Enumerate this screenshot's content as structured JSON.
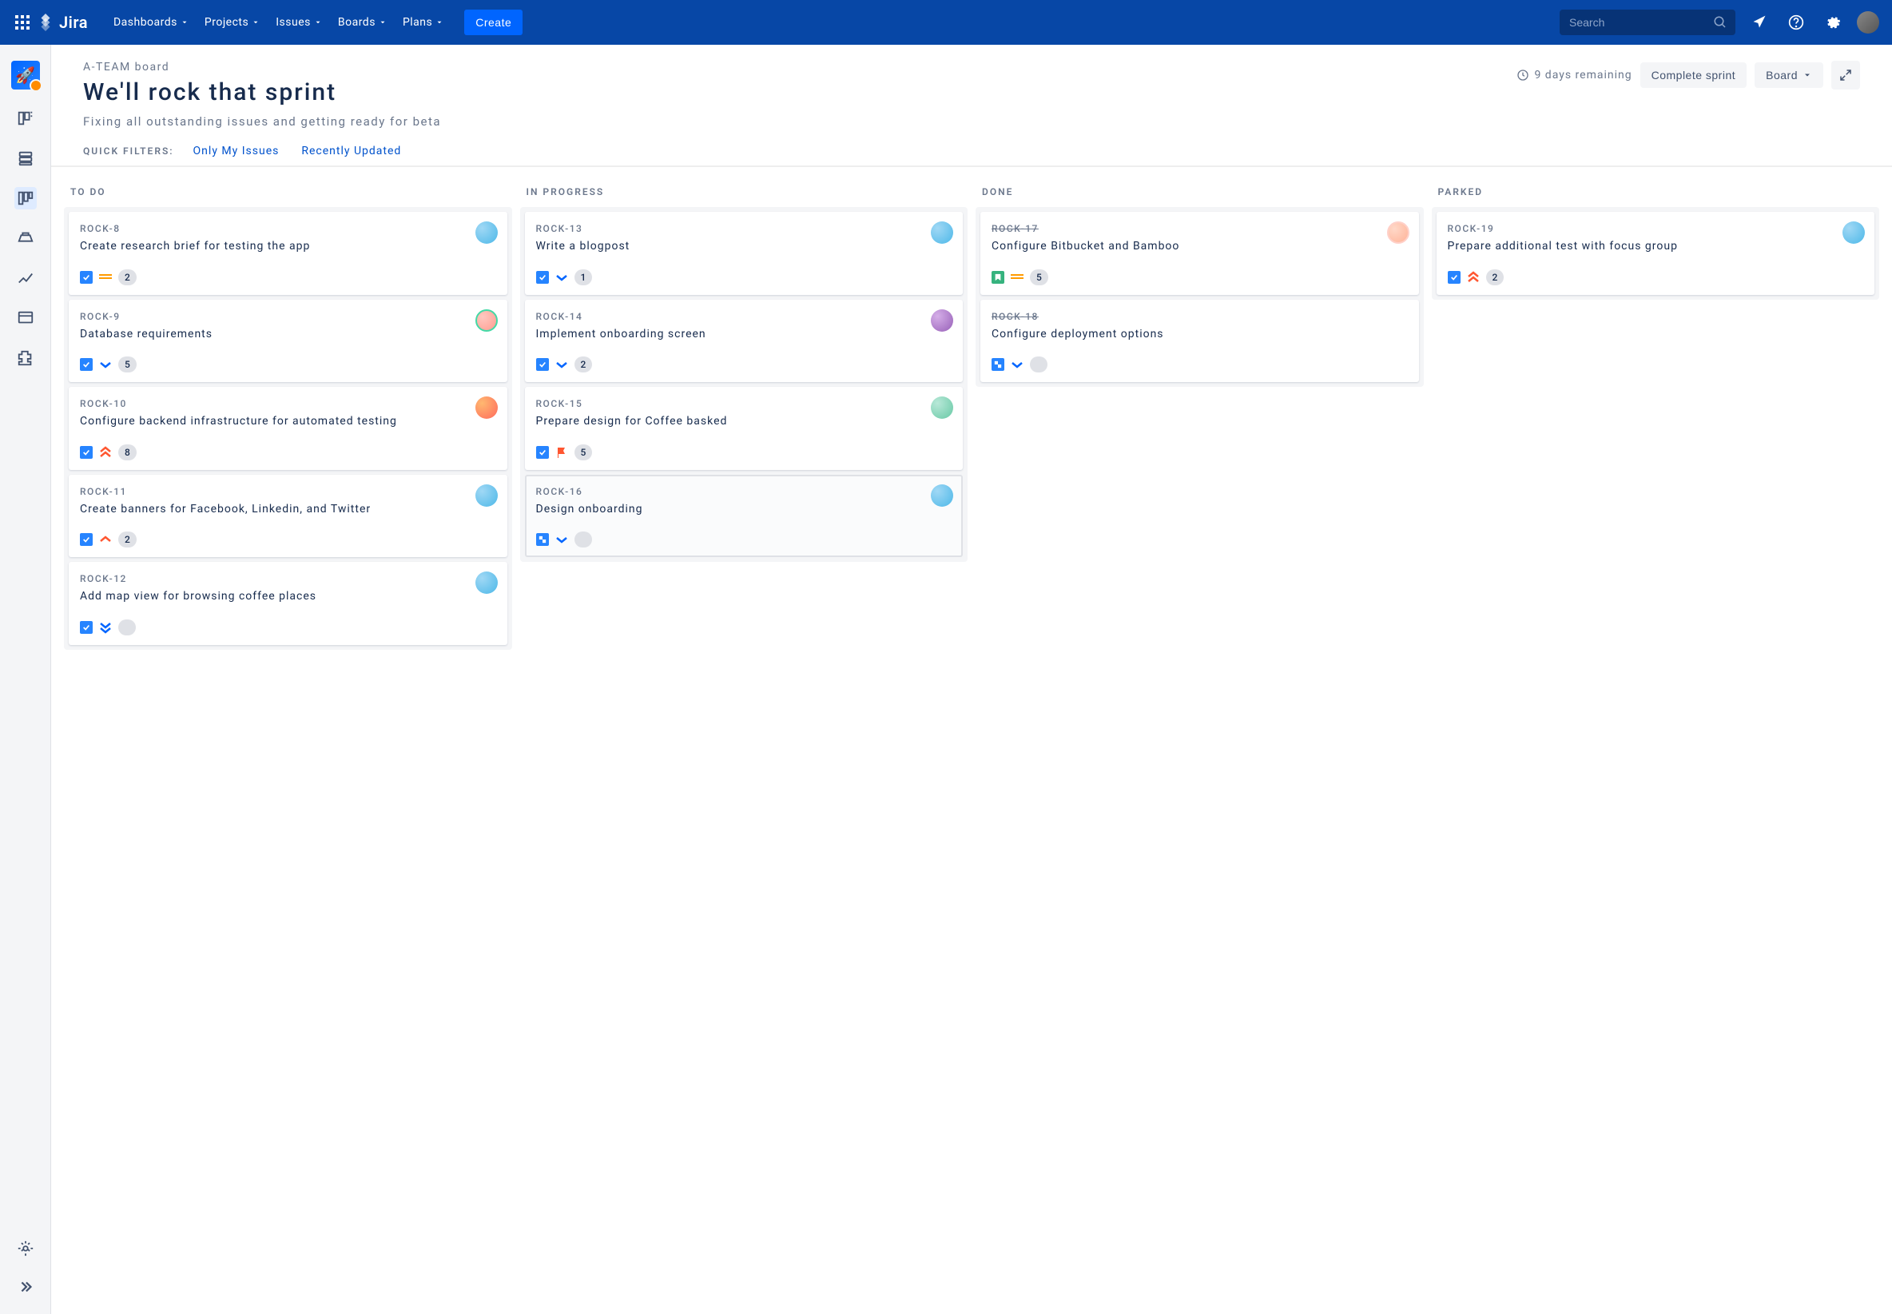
{
  "topbar": {
    "logo": "Jira",
    "nav": [
      "Dashboards",
      "Projects",
      "Issues",
      "Boards",
      "Plans"
    ],
    "create": "Create",
    "search_placeholder": "Search"
  },
  "header": {
    "breadcrumb": "A-TEAM board",
    "title": "We'll rock that sprint",
    "subtitle": "Fixing all outstanding issues and getting ready for beta",
    "remaining": "9 days remaining",
    "complete": "Complete sprint",
    "view_btn": "Board",
    "filters_label": "QUICK FILTERS:",
    "filters": [
      "Only My Issues",
      "Recently Updated"
    ]
  },
  "columns": [
    {
      "name": "TO DO",
      "cards": [
        {
          "id": "ROCK-8",
          "title": "Create research brief for testing the app",
          "avatar": "av-blue",
          "type": "task",
          "priority": "medium",
          "estimate": "2"
        },
        {
          "id": "ROCK-9",
          "title": "Database requirements",
          "avatar": "av-pink",
          "type": "task",
          "priority": "low",
          "estimate": "5"
        },
        {
          "id": "ROCK-10",
          "title": "Configure backend infrastructure for automated testing",
          "avatar": "av-orange",
          "type": "task",
          "priority": "highest",
          "estimate": "8"
        },
        {
          "id": "ROCK-11",
          "title": "Create banners for Facebook, Linkedin, and Twitter",
          "avatar": "av-blue",
          "type": "task",
          "priority": "high",
          "estimate": "2"
        },
        {
          "id": "ROCK-12",
          "title": "Add map view for browsing coffee places",
          "avatar": "av-blue",
          "type": "task",
          "priority": "lowest",
          "estimate": ""
        }
      ]
    },
    {
      "name": "IN PROGRESS",
      "cards": [
        {
          "id": "ROCK-13",
          "title": "Write a blogpost",
          "avatar": "av-blue",
          "type": "task",
          "priority": "low",
          "estimate": "1"
        },
        {
          "id": "ROCK-14",
          "title": "Implement onboarding screen",
          "avatar": "av-purple",
          "type": "task",
          "priority": "low",
          "estimate": "2"
        },
        {
          "id": "ROCK-15",
          "title": "Prepare design for Coffee basked",
          "avatar": "av-green",
          "type": "task",
          "priority": "flag",
          "estimate": "5"
        },
        {
          "id": "ROCK-16",
          "title": "Design onboarding",
          "avatar": "av-blue",
          "type": "subtask",
          "priority": "low",
          "estimate": "",
          "selected": true
        }
      ]
    },
    {
      "name": "DONE",
      "cards": [
        {
          "id": "ROCK-17",
          "title": "Configure Bitbucket and Bamboo",
          "avatar": "av-peach",
          "type": "story",
          "priority": "medium",
          "estimate": "5",
          "done": true
        },
        {
          "id": "ROCK-18",
          "title": "Configure deployment options",
          "avatar": "",
          "type": "subtask",
          "priority": "low",
          "estimate": "",
          "done": true
        }
      ]
    },
    {
      "name": "PARKED",
      "cards": [
        {
          "id": "ROCK-19",
          "title": "Prepare additional test with focus group",
          "avatar": "av-blue",
          "type": "task",
          "priority": "highest",
          "estimate": "2"
        }
      ]
    }
  ]
}
